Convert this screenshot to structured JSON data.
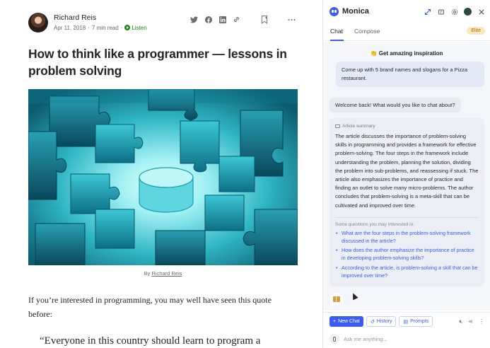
{
  "article": {
    "author": "Richard Reis",
    "date": "Apr 11, 2018",
    "read_time": "7 min read",
    "listen": "Listen",
    "title": "How to think like a programmer — lessons in problem solving",
    "caption_prefix": "By",
    "caption_author": "Richard Reis",
    "body": "If you’re interested in programming, you may well have seen this quote before:",
    "quote": "“Everyone in this country should learn to program a"
  },
  "panel": {
    "brand": "Monica",
    "tabs": [
      "Chat",
      "Compose"
    ],
    "badge": "Elite",
    "inspiration_title": "👏 Get amazing inspiration",
    "inspiration_prompt": "Come up with 5 brand names and slogans for a Pizza restaurant.",
    "welcome": "Welcome back! What would you like to chat about?",
    "summary_label": "Article summary",
    "summary_text": "The article discusses the importance of problem-solving skills in programming and provides a framework for effective problem-solving. The four steps in the framework include understanding the problem, planning the solution, dividing the problem into sub-problems, and reassessing if stuck. The article also emphasizes the importance of practice and finding an outlet to solve many micro-problems. The author concludes that problem-solving is a meta-skill that can be cultivated and improved over time.",
    "questions_label": "Some questions you may interested in:",
    "questions": [
      "What are the four steps in the problem-solving framework discussed in the article?",
      "How does the author emphasize the importance of practice in developing problem-solving skills?",
      "According to the article, is problem-solving a skill that can be improved over time?"
    ],
    "buttons": {
      "new_chat": "New Chat",
      "history": "History",
      "prompts": "Prompts"
    },
    "ask_placeholder": "Ask me anything..."
  }
}
